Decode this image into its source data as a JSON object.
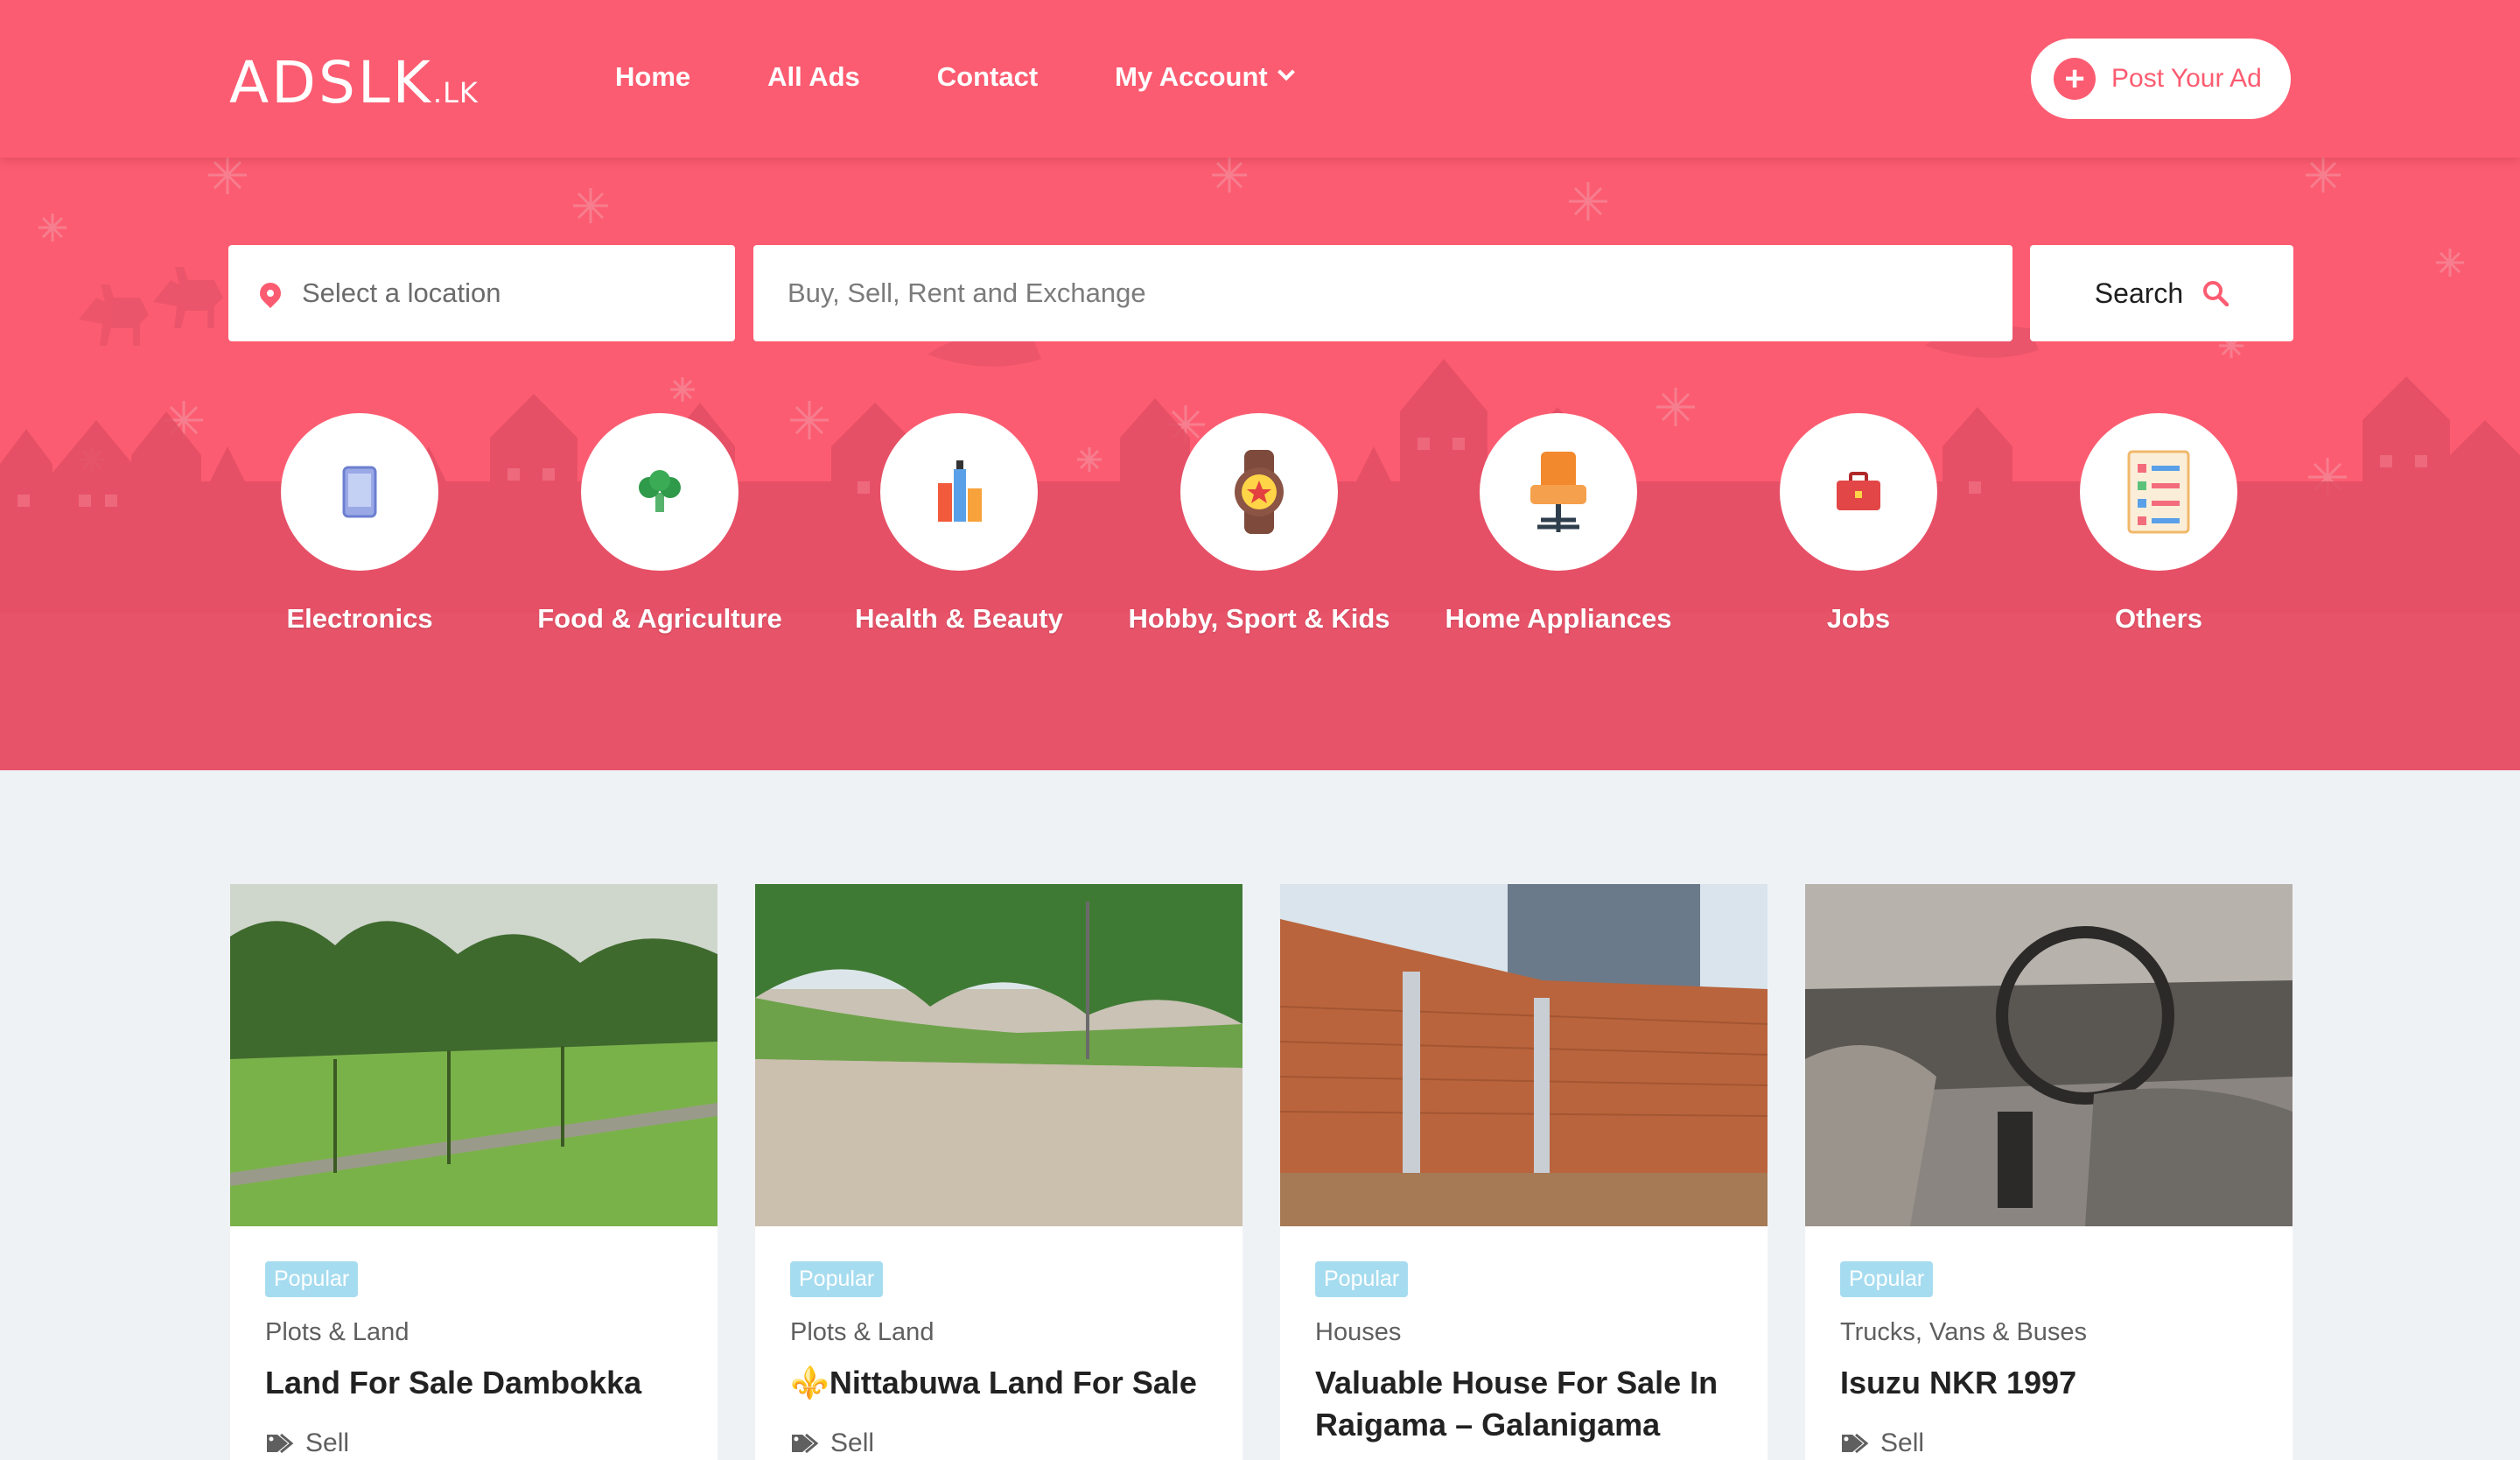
{
  "brand": {
    "name": "ADSLK",
    "tld": ".LK"
  },
  "nav": [
    {
      "label": "Home"
    },
    {
      "label": "All Ads"
    },
    {
      "label": "Contact"
    },
    {
      "label": "My Account"
    }
  ],
  "post_button": {
    "label": "Post Your Ad"
  },
  "search": {
    "location_placeholder": "Select a location",
    "query_placeholder": "Buy, Sell, Rent and Exchange",
    "button_label": "Search"
  },
  "categories": [
    {
      "label": "Electronics",
      "icon": "phone-icon"
    },
    {
      "label": "Food & Agriculture",
      "icon": "broccoli-icon"
    },
    {
      "label": "Health & Beauty",
      "icon": "cosmetics-icon"
    },
    {
      "label": "Hobby, Sport & Kids",
      "icon": "watch-icon"
    },
    {
      "label": "Home Appliances",
      "icon": "chair-icon"
    },
    {
      "label": "Jobs",
      "icon": "briefcase-icon"
    },
    {
      "label": "Others",
      "icon": "checklist-icon"
    }
  ],
  "listings": [
    {
      "badge": "Popular",
      "category": "Plots & Land",
      "title": "Land For Sale Dambokka",
      "type": "Sell"
    },
    {
      "badge": "Popular",
      "category": "Plots & Land",
      "title": "⚜️Nittabuwa Land For Sale",
      "type": "Sell"
    },
    {
      "badge": "Popular",
      "category": "Houses",
      "title": "Valuable House For Sale In Raigama – Galanigama",
      "type": "Sell"
    },
    {
      "badge": "Popular",
      "category": "Trucks, Vans & Buses",
      "title": "Isuzu NKR 1997",
      "type": "Sell"
    }
  ],
  "colors": {
    "brand": "#fc5c71",
    "badge": "#a6dcef",
    "page_bg": "#eff2f5"
  }
}
